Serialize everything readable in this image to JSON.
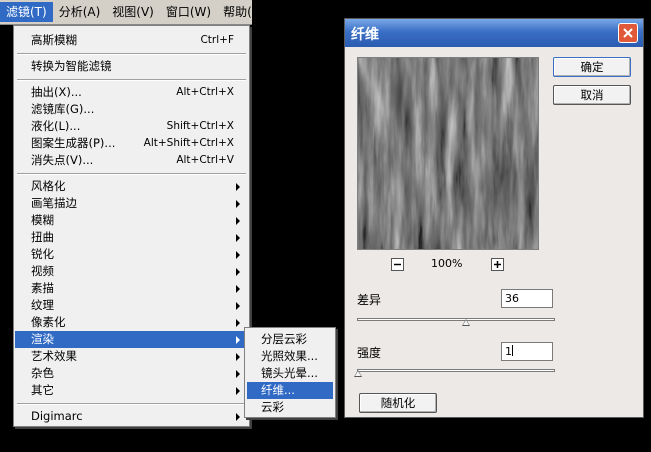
{
  "menubar": {
    "items": [
      "滤镜(T)",
      "分析(A)",
      "视图(V)",
      "窗口(W)",
      "帮助("
    ],
    "active_index": 0
  },
  "filter_menu": {
    "groups": [
      [
        {
          "label": "高斯模糊",
          "shortcut": "Ctrl+F"
        }
      ],
      [
        {
          "label": "转换为智能滤镜"
        }
      ],
      [
        {
          "label": "抽出(X)...",
          "shortcut": "Alt+Ctrl+X"
        },
        {
          "label": "滤镜库(G)..."
        },
        {
          "label": "液化(L)...",
          "shortcut": "Shift+Ctrl+X"
        },
        {
          "label": "图案生成器(P)...",
          "shortcut": "Alt+Shift+Ctrl+X"
        },
        {
          "label": "消失点(V)...",
          "shortcut": "Alt+Ctrl+V"
        }
      ],
      [
        {
          "label": "风格化",
          "submenu": true
        },
        {
          "label": "画笔描边",
          "submenu": true
        },
        {
          "label": "模糊",
          "submenu": true
        },
        {
          "label": "扭曲",
          "submenu": true
        },
        {
          "label": "锐化",
          "submenu": true
        },
        {
          "label": "视频",
          "submenu": true
        },
        {
          "label": "素描",
          "submenu": true
        },
        {
          "label": "纹理",
          "submenu": true
        },
        {
          "label": "像素化",
          "submenu": true
        },
        {
          "label": "渲染",
          "submenu": true,
          "highlighted": true
        },
        {
          "label": "艺术效果",
          "submenu": true
        },
        {
          "label": "杂色",
          "submenu": true
        },
        {
          "label": "其它",
          "submenu": true
        }
      ],
      [
        {
          "label": "Digimarc",
          "submenu": true
        }
      ]
    ]
  },
  "render_submenu": {
    "items": [
      "分层云彩",
      "光照效果...",
      "镜头光晕...",
      "纤维...",
      "云彩"
    ],
    "highlighted_index": 3
  },
  "dialog": {
    "title": "纤维",
    "ok_label": "确定",
    "cancel_label": "取消",
    "zoom_level": "100%",
    "variance_label": "差异",
    "variance_value": "36",
    "variance_slider": 0.55,
    "strength_label": "强度",
    "strength_value": "1",
    "strength_slider": 0.0,
    "randomize_label": "随机化"
  },
  "colors": {
    "menu_highlight": "#316ac5",
    "title_bar": "#3a6fc5",
    "close_button": "#e05a3a"
  }
}
